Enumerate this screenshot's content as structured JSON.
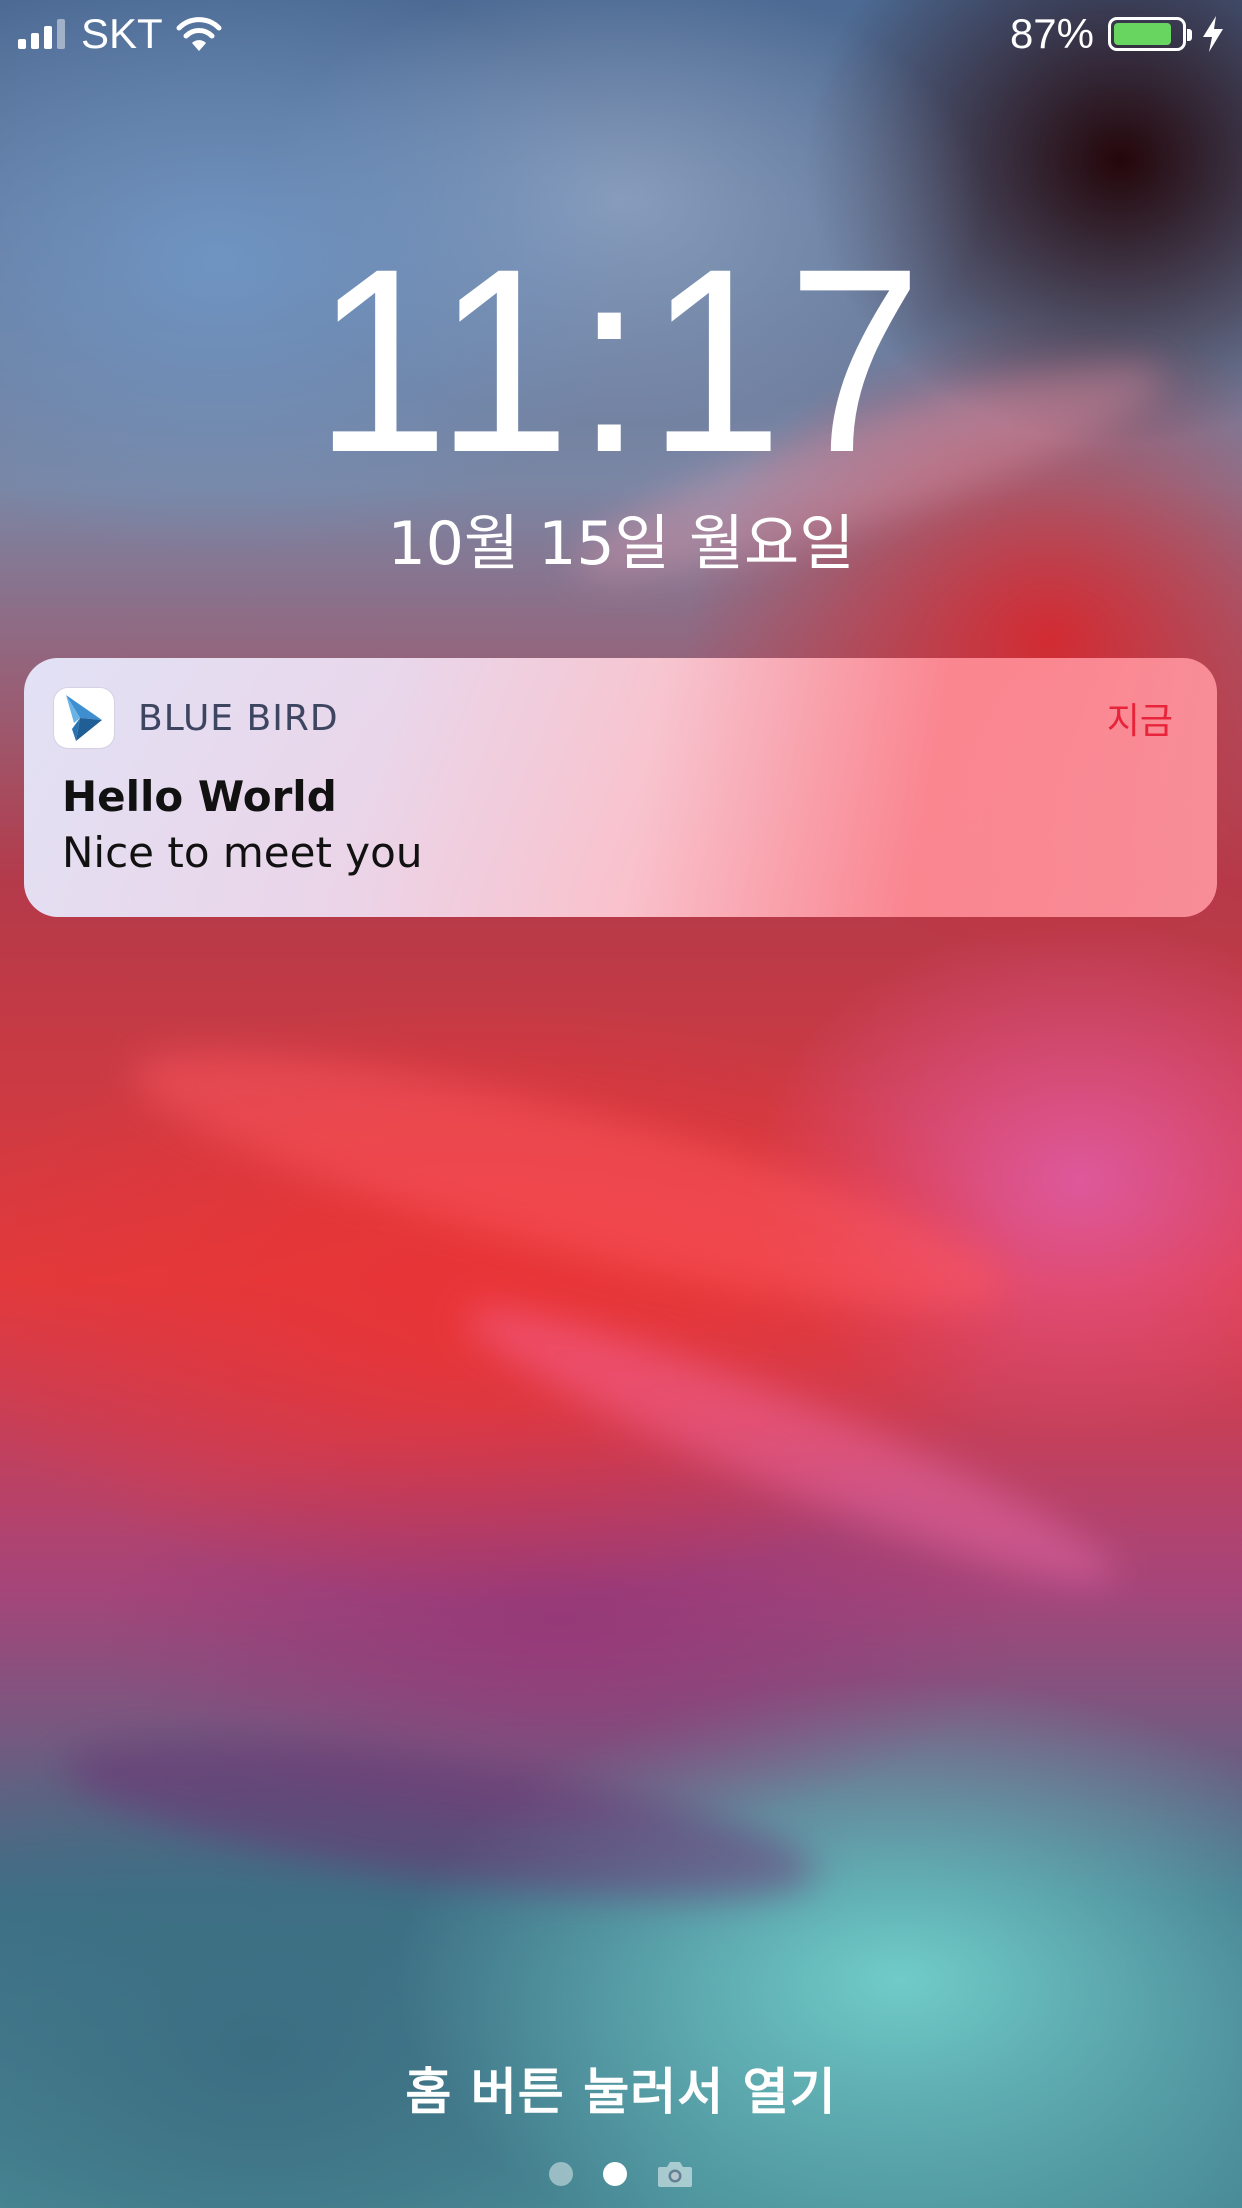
{
  "status_bar": {
    "carrier": "SKT",
    "battery_percent": "87%",
    "battery_level": 0.87,
    "signal_bars": 3,
    "signal_bars_total": 4,
    "charging": true,
    "icons": [
      "signal-icon",
      "wifi-icon",
      "battery-icon",
      "charging-bolt-icon"
    ]
  },
  "lock_screen": {
    "time": "11:17",
    "date": "10월 15일 월요일"
  },
  "notification": {
    "app_name": "BLUE BIRD",
    "time": "지금",
    "title": "Hello World",
    "body": "Nice to meet you",
    "app_icon": "blue-bird-app-icon",
    "time_color": "#e8243a"
  },
  "bottom": {
    "unlock_hint": "홈 버튼 눌러서 열기",
    "page_indicator": {
      "count": 2,
      "active_index": 1,
      "trailing_icon": "camera-icon"
    }
  }
}
